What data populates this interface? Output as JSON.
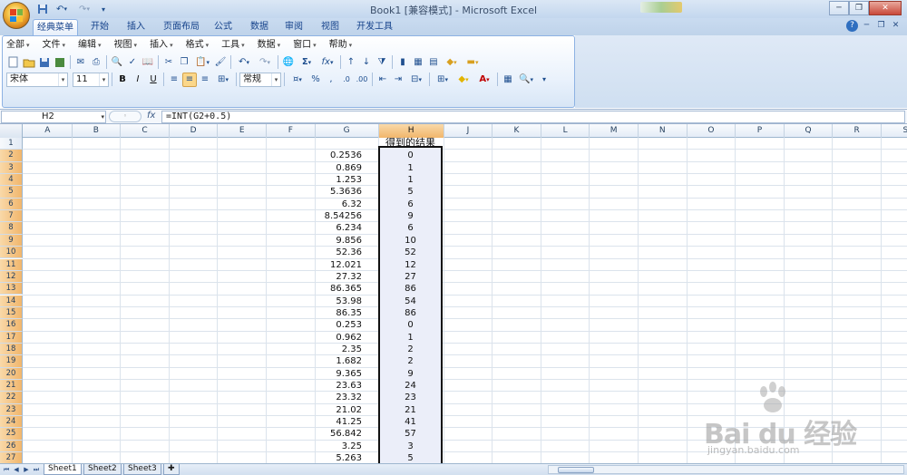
{
  "window": {
    "title": "Book1  [兼容模式] - Microsoft Excel",
    "qat_icons": [
      "save-icon",
      "undo-icon",
      "redo-icon",
      "customize-icon"
    ]
  },
  "ribbon_tabs": [
    {
      "label": "经典菜单",
      "active": true
    },
    {
      "label": "开始"
    },
    {
      "label": "插入"
    },
    {
      "label": "页面布局"
    },
    {
      "label": "公式"
    },
    {
      "label": "数据"
    },
    {
      "label": "审阅"
    },
    {
      "label": "视图"
    },
    {
      "label": "开发工具"
    }
  ],
  "classic_menu": [
    "全部",
    "文件",
    "编辑",
    "视图",
    "插入",
    "格式",
    "工具",
    "数据",
    "窗口",
    "帮助"
  ],
  "formatting": {
    "font": "宋体",
    "size": "11",
    "bold": "B",
    "italic": "I",
    "underline": "U",
    "number_format": "常规",
    "percent": "%",
    "comma": ","
  },
  "formula_bar": {
    "name_box": "H2",
    "fx": "fx",
    "formula": "=INT(G2+0.5)"
  },
  "columns": [
    "A",
    "B",
    "C",
    "D",
    "E",
    "F",
    "G",
    "H",
    "J",
    "K",
    "L",
    "M",
    "N",
    "O",
    "P",
    "Q",
    "R",
    "S"
  ],
  "selected_column": "H",
  "rows": [
    "1",
    "2",
    "3",
    "4",
    "5",
    "6",
    "7",
    "8",
    "9",
    "10",
    "11",
    "12",
    "13",
    "14",
    "15",
    "16",
    "17",
    "18",
    "19",
    "20",
    "21",
    "22",
    "23",
    "24",
    "25",
    "26",
    "27"
  ],
  "header_H1": "得到的结果",
  "values_G": [
    "0.2536",
    "0.869",
    "1.253",
    "5.3636",
    "6.32",
    "8.54256",
    "6.234",
    "9.856",
    "52.36",
    "12.021",
    "27.32",
    "86.365",
    "53.98",
    "86.35",
    "0.253",
    "0.962",
    "2.35",
    "1.682",
    "9.365",
    "23.63",
    "23.32",
    "21.02",
    "41.25",
    "56.842",
    "3.25",
    "5.263"
  ],
  "values_H": [
    "0",
    "1",
    "1",
    "5",
    "6",
    "9",
    "6",
    "10",
    "52",
    "12",
    "27",
    "86",
    "54",
    "86",
    "0",
    "1",
    "2",
    "2",
    "9",
    "24",
    "23",
    "21",
    "41",
    "57",
    "3",
    "5"
  ],
  "sheets": [
    "Sheet1",
    "Sheet2",
    "Sheet3"
  ],
  "active_sheet": "Sheet1",
  "watermark": {
    "logo": "Bai du 经验",
    "url": "jingyan.baidu.com"
  }
}
